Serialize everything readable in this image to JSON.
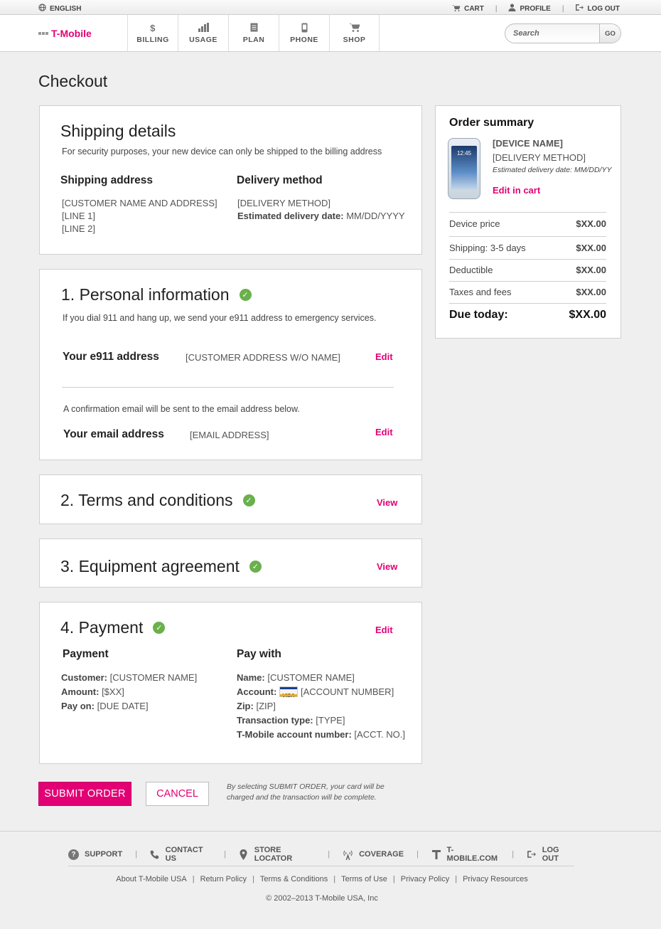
{
  "utility": {
    "language": "ENGLISH",
    "cart": "CART",
    "profile": "PROFILE",
    "logout": "LOG OUT"
  },
  "brand": {
    "name": "T-Mobile"
  },
  "nav": {
    "items": [
      {
        "label": "BILLING",
        "icon": "dollar-icon"
      },
      {
        "label": "USAGE",
        "icon": "bar-chart-icon"
      },
      {
        "label": "PLAN",
        "icon": "document-icon"
      },
      {
        "label": "PHONE",
        "icon": "phone-icon"
      },
      {
        "label": "SHOP",
        "icon": "cart-icon"
      }
    ]
  },
  "search": {
    "placeholder": "Search",
    "go_label": "GO"
  },
  "page": {
    "title": "Checkout"
  },
  "shipping": {
    "title": "Shipping details",
    "note": "For security purposes, your new device can only be shipped to the billing address",
    "address_label": "Shipping address",
    "address_lines": [
      "[CUSTOMER NAME AND ADDRESS]",
      "[LINE 1]",
      "[LINE 2]"
    ],
    "delivery_label": "Delivery method",
    "delivery_method": "[DELIVERY METHOD]",
    "estimated_label": "Estimated delivery date:",
    "estimated_value": "MM/DD/YYYY"
  },
  "personal": {
    "title": "1. Personal information",
    "note": "If you dial 911 and hang up, we send your e911 address to emergency services.",
    "e911_label": "Your e911 address",
    "e911_value": "[CUSTOMER ADDRESS W/O NAME]",
    "e911_action": "Edit",
    "email_note": "A confirmation email will be sent to the email address below.",
    "email_label": "Your email address",
    "email_value": "[EMAIL ADDRESS]",
    "email_action": "Edit"
  },
  "terms": {
    "title": "2. Terms and conditions",
    "action": "View"
  },
  "equipment": {
    "title": "3. Equipment agreement",
    "action": "View"
  },
  "payment": {
    "title": "4. Payment",
    "action": "Edit",
    "payment_label": "Payment",
    "customer_label": "Customer:",
    "customer_value": "[CUSTOMER NAME]",
    "amount_label": "Amount:",
    "amount_value": "[$XX]",
    "payon_label": "Pay on:",
    "payon_value": "[DUE DATE]",
    "paywith_label": "Pay with",
    "name_label": "Name:",
    "name_value": "[CUSTOMER NAME]",
    "account_label": "Account:",
    "account_value": "[ACCOUNT NUMBER]",
    "card_brand": "VISA",
    "zip_label": "Zip:",
    "zip_value": "[ZIP]",
    "txn_label": "Transaction type:",
    "txn_value": "[TYPE]",
    "tmo_label": "T-Mobile account number:",
    "tmo_value": "[ACCT. NO.]"
  },
  "summary": {
    "title": "Order summary",
    "device_name": "[DEVICE NAME]",
    "delivery_method": "[DELIVERY METHOD]",
    "estimated": "Estimated delivery date: MM/DD/YY",
    "phone_time": "12:45",
    "edit_link": "Edit in cart",
    "rows": [
      {
        "label": "Device price",
        "amount": "$XX.00"
      },
      {
        "label": "Shipping: 3-5 days",
        "amount": "$XX.00"
      },
      {
        "label": "Deductible",
        "amount": "$XX.00"
      },
      {
        "label": "Taxes and fees",
        "amount": "$XX.00"
      }
    ],
    "total_label": "Due today:",
    "total_amount": "$XX.00"
  },
  "actions": {
    "submit": "SUBMIT ORDER",
    "cancel": "CANCEL",
    "disclaimer": "By selecting SUBMIT ORDER, your card will be charged and the transaction will be complete."
  },
  "footer": {
    "nav": [
      {
        "label": "SUPPORT",
        "icon": "help-icon"
      },
      {
        "label": "CONTACT US",
        "icon": "phone-handset-icon"
      },
      {
        "label": "STORE LOCATOR",
        "icon": "map-pin-icon"
      },
      {
        "label": "COVERAGE",
        "icon": "signal-tower-icon"
      },
      {
        "label": "T-MOBILE.COM",
        "icon": "t-logo-icon"
      },
      {
        "label": "LOG OUT",
        "icon": "logout-icon"
      }
    ],
    "links": [
      "About T-Mobile USA",
      "Return Policy",
      "Terms & Conditions",
      "Terms of Use",
      "Privacy Policy",
      "Privacy Resources"
    ],
    "copyright": "© 2002–2013 T-Mobile USA, Inc"
  }
}
